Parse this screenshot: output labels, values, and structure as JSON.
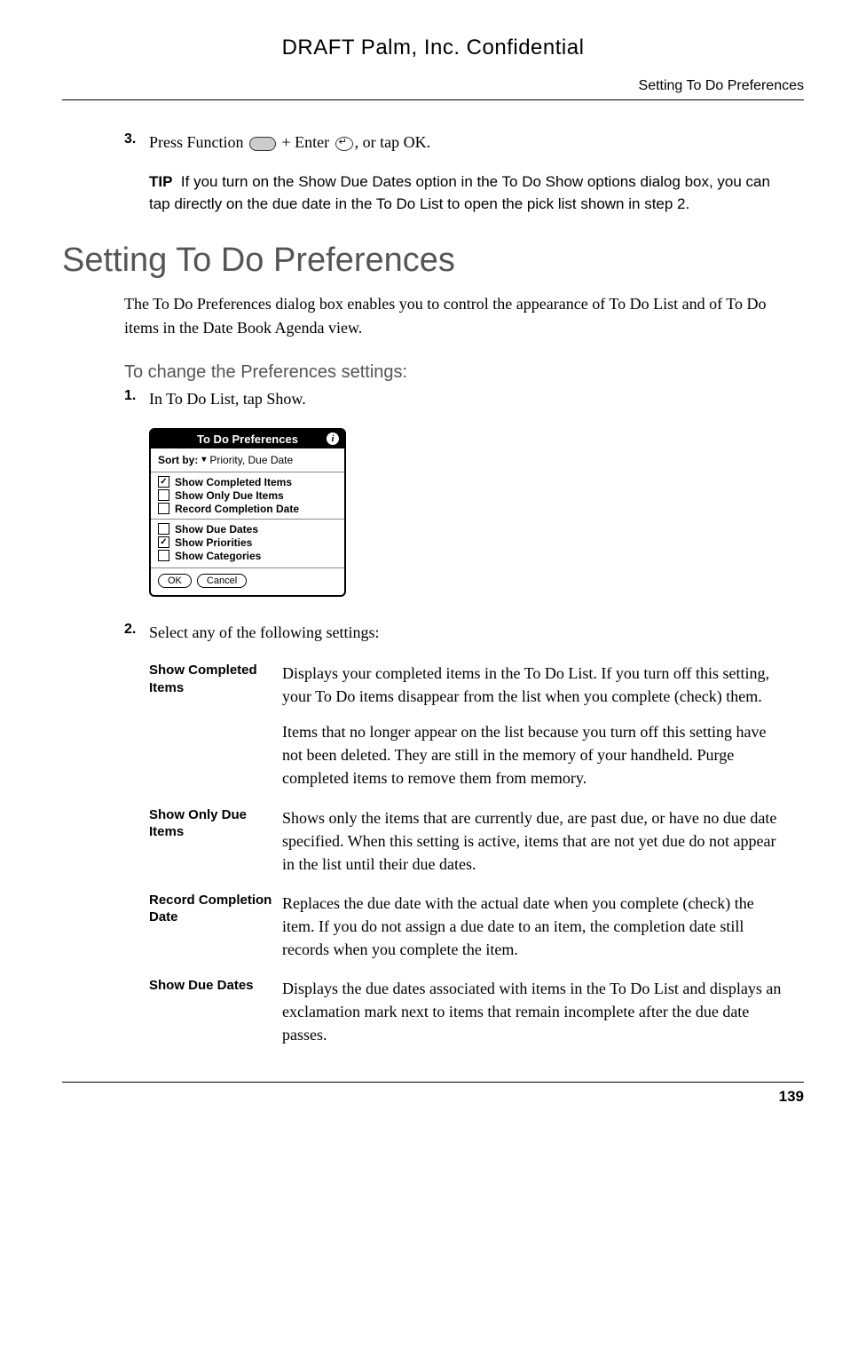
{
  "draft_header": "DRAFT   Palm, Inc. Confidential",
  "running_header": "Setting To Do Preferences",
  "step3": {
    "num": "3.",
    "pre": "Press Function ",
    "mid": " + Enter ",
    "post": ", or tap OK."
  },
  "tip": {
    "label": "TIP",
    "text": "If you turn on the Show Due Dates option in the To Do Show options dialog box, you can tap directly on the due date in the To Do List to open the pick list shown in step 2."
  },
  "section_heading": "Setting To Do Preferences",
  "section_intro": "The To Do Preferences dialog box enables you to control the appearance of To Do List and of To Do items in the Date Book Agenda view.",
  "procedure_heading": "To change the Preferences settings:",
  "step1": {
    "num": "1.",
    "text": "In To Do List, tap Show."
  },
  "dialog": {
    "title": "To Do Preferences",
    "sortby_label": "Sort by:",
    "sortby_value": "Priority, Due Date",
    "options": [
      {
        "label": "Show Completed Items",
        "checked": true
      },
      {
        "label": "Show Only Due Items",
        "checked": false
      },
      {
        "label": "Record Completion Date",
        "checked": false
      }
    ],
    "options2": [
      {
        "label": "Show Due Dates",
        "checked": false
      },
      {
        "label": "Show Priorities",
        "checked": true
      },
      {
        "label": "Show Categories",
        "checked": false
      }
    ],
    "ok": "OK",
    "cancel": "Cancel"
  },
  "step2": {
    "num": "2.",
    "text": "Select any of the following settings:"
  },
  "table": [
    {
      "name": "Show Completed Items",
      "desc": [
        "Displays your completed items in the To Do List. If you turn off this setting, your To Do items disappear from the list when you complete (check) them.",
        "Items that no longer appear on the list because you turn off this setting have not been deleted. They are still in the memory of your handheld. Purge completed items to remove them from memory."
      ]
    },
    {
      "name": "Show Only Due Items",
      "desc": [
        "Shows only the items that are currently due, are past due, or have no due date specified. When this setting is active, items that are not yet due do not appear in the list until their due dates."
      ]
    },
    {
      "name": "Record Completion Date",
      "desc": [
        "Replaces the due date with the actual date when you complete (check) the item. If you do not assign a due date to an item, the completion date still records when you complete the item."
      ]
    },
    {
      "name": "Show Due Dates",
      "desc": [
        "Displays the due dates associated with items in the To Do List and displays an exclamation mark next to items that remain incomplete after the due date passes."
      ]
    }
  ],
  "page_number": "139"
}
